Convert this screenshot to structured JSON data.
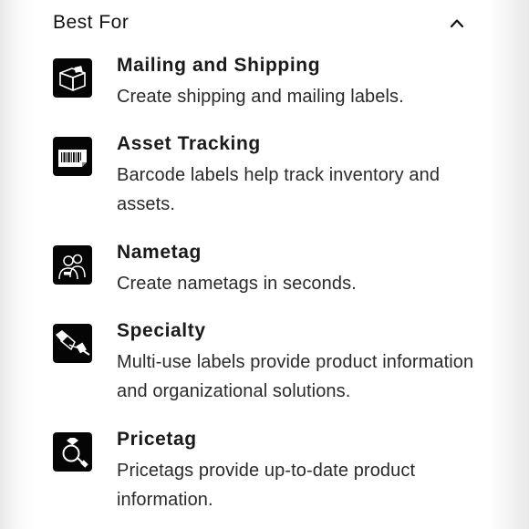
{
  "section": {
    "title": "Best For",
    "toggle_icon": "chevron-up-icon"
  },
  "items": [
    {
      "title": "Mailing and Shipping",
      "description": "Create shipping and mailing labels.",
      "icon": "package-box-icon"
    },
    {
      "title": "Asset Tracking",
      "description": "Barcode labels help track inventory and assets.",
      "icon": "barcode-label-icon"
    },
    {
      "title": "Nametag",
      "description": "Create nametags in seconds.",
      "icon": "people-nametag-icon"
    },
    {
      "title": "Specialty",
      "description": "Multi-use labels provide product information and organizational solutions.",
      "icon": "hand-tag-icon"
    },
    {
      "title": "Pricetag",
      "description": "Pricetags provide up-to-date product information.",
      "icon": "ring-pricetag-icon"
    }
  ],
  "colors": {
    "icon_background": "#050505",
    "text_primary": "#1a1a1a"
  }
}
